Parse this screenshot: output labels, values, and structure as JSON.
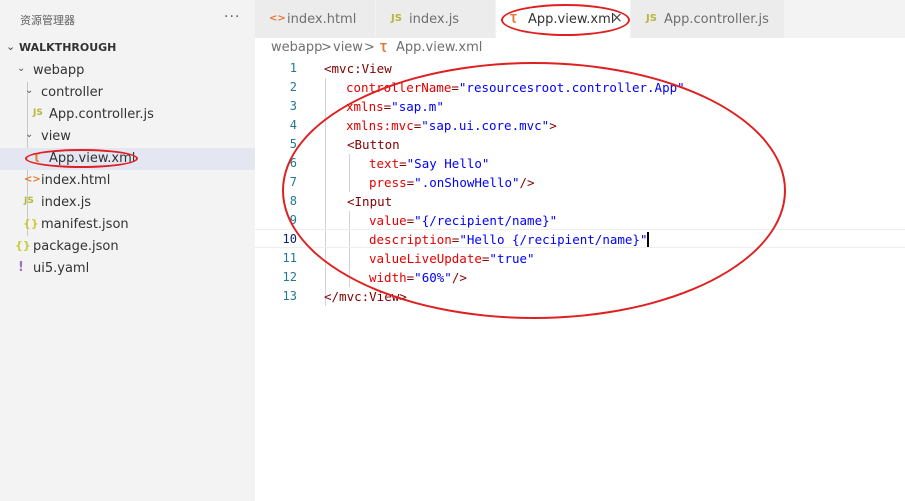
{
  "sidebar": {
    "title": "资源管理器",
    "more": "···",
    "section_title": "WALKTHROUGH",
    "items": [
      {
        "label": "webapp",
        "icon": "chevron-down-icon"
      },
      {
        "label": "controller",
        "icon": "chevron-down-icon"
      },
      {
        "label": "App.controller.js",
        "icon": "js-file-icon",
        "icon_text": "JS"
      },
      {
        "label": "view",
        "icon": "chevron-down-icon"
      },
      {
        "label": "App.view.xml",
        "icon": "rss-xml-file-icon",
        "icon_text": "Ʈ"
      },
      {
        "label": "index.html",
        "icon": "html-file-icon",
        "icon_text": "<>"
      },
      {
        "label": "index.js",
        "icon": "js-file-icon",
        "icon_text": "JS"
      },
      {
        "label": "manifest.json",
        "icon": "json-file-icon",
        "icon_text": "{}"
      },
      {
        "label": "package.json",
        "icon": "json-file-icon",
        "icon_text": "{}"
      },
      {
        "label": "ui5.yaml",
        "icon": "yaml-file-icon",
        "icon_text": "!"
      }
    ]
  },
  "tabs": [
    {
      "label": "index.html",
      "icon_text": "<>"
    },
    {
      "label": "index.js",
      "icon_text": "JS"
    },
    {
      "label": "App.view.xml",
      "icon_text": "Ʈ",
      "close": "×"
    },
    {
      "label": "App.controller.js",
      "icon_text": "JS"
    }
  ],
  "breadcrumb": {
    "part1": "webapp",
    "sep1": ">",
    "part2": "view",
    "sep2": ">",
    "icon_text": "Ʈ",
    "part3": "App.view.xml"
  },
  "editor": {
    "line_numbers": [
      "1",
      "2",
      "3",
      "4",
      "5",
      "6",
      "7",
      "8",
      "9",
      "10",
      "11",
      "12",
      "13"
    ],
    "lines": [
      {
        "t1": "<mvc:View"
      },
      {
        "a": "controllerName",
        "eq": "=",
        "v": "\"resourcesroot.controller.App\""
      },
      {
        "a": "xmlns",
        "eq": "=",
        "v": "\"sap.m\""
      },
      {
        "a": "xmlns:mvc",
        "eq": "=",
        "v": "\"sap.ui.core.mvc\"",
        "tail": ">"
      },
      {
        "t1": "<Button"
      },
      {
        "a": "text",
        "eq": "=",
        "v": "\"Say Hello\""
      },
      {
        "a": "press",
        "eq": "=",
        "v": "\".onShowHello\"",
        "tail": "/>"
      },
      {
        "t1": "<Input"
      },
      {
        "a": "value",
        "eq": "=",
        "v": "\"{/recipient/name}\""
      },
      {
        "a": "description",
        "eq": "=",
        "v": "\"Hello {/recipient/name}\""
      },
      {
        "a": "valueLiveUpdate",
        "eq": "=",
        "v": "\"true\""
      },
      {
        "a": "width",
        "eq": "=",
        "v": "\"60%\"",
        "tail": "/>"
      },
      {
        "t1": "</mvc:View>"
      }
    ]
  },
  "colors": {
    "annotation": "#e02020",
    "tag": "#800000",
    "attribute": "#e50000",
    "value": "#0000ff",
    "line_number": "#237893"
  }
}
